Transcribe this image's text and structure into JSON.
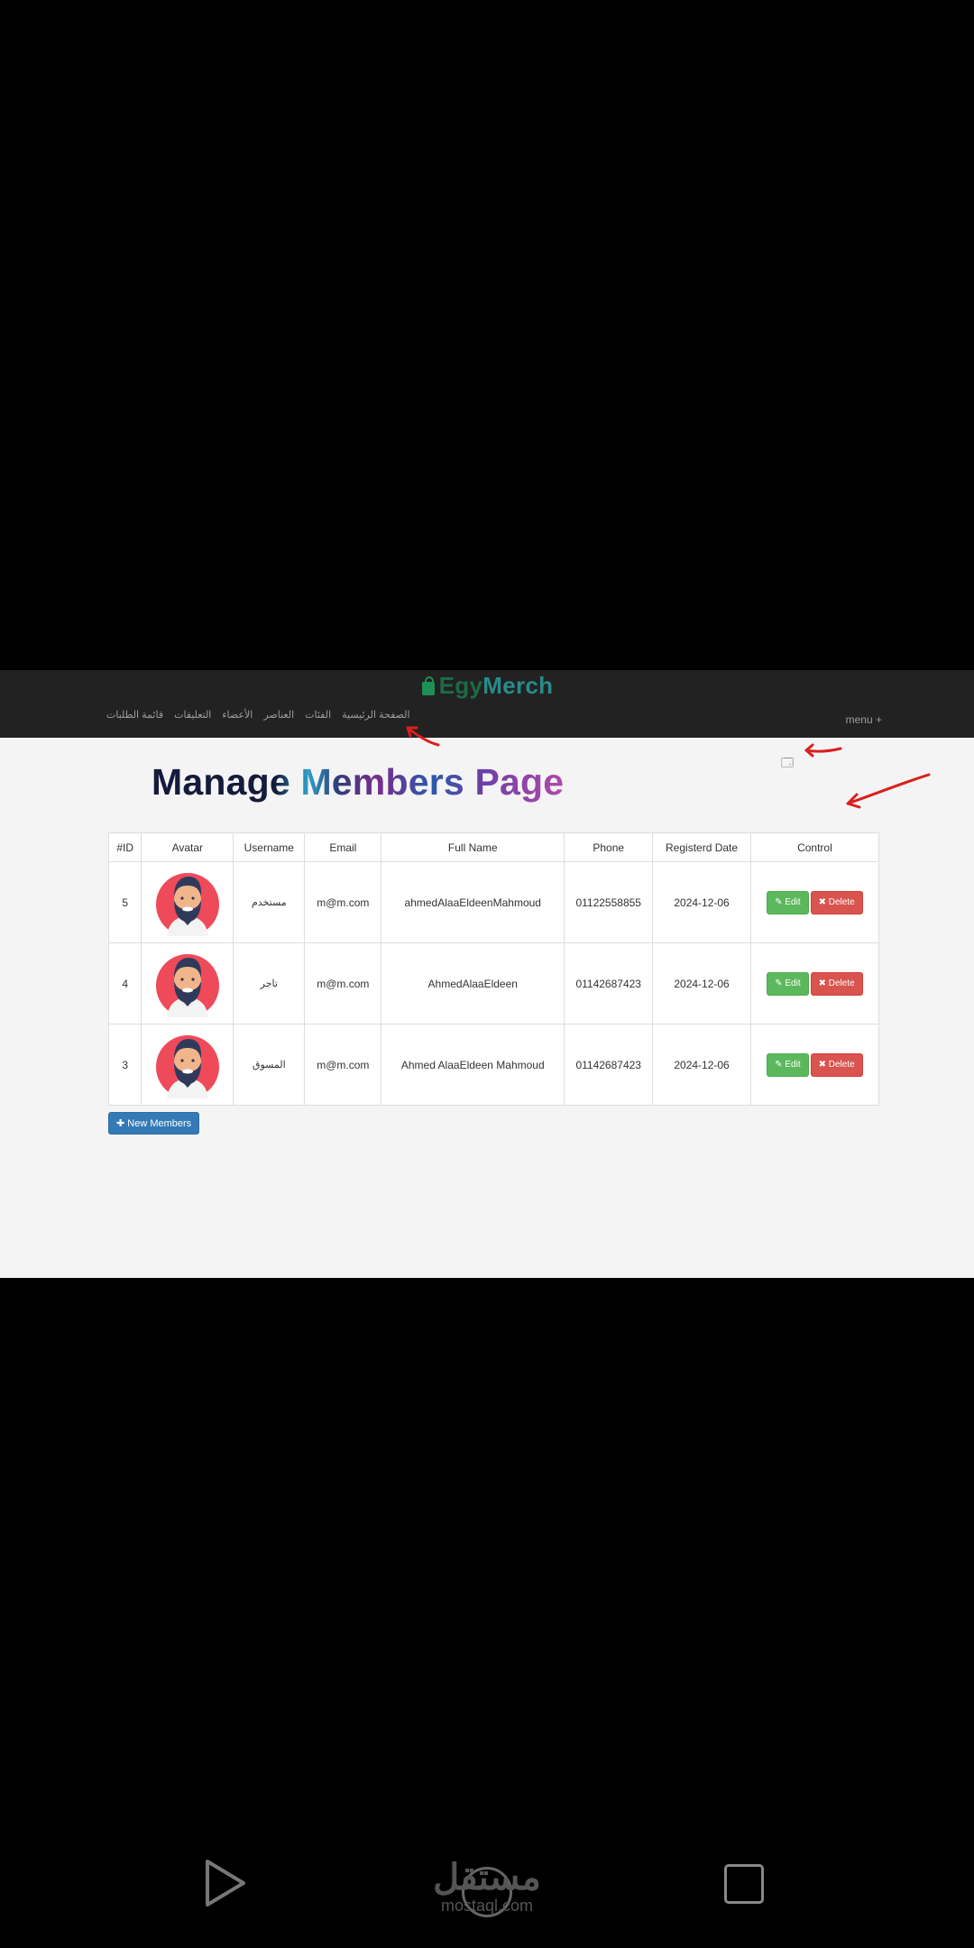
{
  "brand": {
    "part1": "Egy",
    "part2": "Merch"
  },
  "nav": {
    "links": [
      "الصفحة الرئيسية",
      "الفئات",
      "العناصر",
      "الأعضاء",
      "التعليقات",
      "قائمة الطلبات"
    ],
    "menu_label": "menu +"
  },
  "page_title": "Manage Members Page",
  "table": {
    "headers": [
      "#ID",
      "Avatar",
      "Username",
      "Email",
      "Full Name",
      "Phone",
      "Registerd Date",
      "Control"
    ],
    "rows": [
      {
        "id": "5",
        "username": "مستخدم",
        "email": "m@m.com",
        "full_name": "ahmedAlaaEldeenMahmoud",
        "phone": "01122558855",
        "date": "2024-12-06"
      },
      {
        "id": "4",
        "username": "تاجر",
        "email": "m@m.com",
        "full_name": "AhmedAlaaEldeen",
        "phone": "01142687423",
        "date": "2024-12-06"
      },
      {
        "id": "3",
        "username": "المسوق",
        "email": "m@m.com",
        "full_name": "Ahmed AlaaEldeen Mahmoud",
        "phone": "01142687423",
        "date": "2024-12-06"
      }
    ],
    "edit_label": "Edit",
    "delete_label": "Delete"
  },
  "new_members_label": "New Members",
  "watermark": {
    "ar": "مستقل",
    "en": "mostaql.com"
  },
  "colors": {
    "navbar_bg": "#222222",
    "edit": "#5cb85c",
    "delete": "#d9534f",
    "primary": "#337ab7",
    "annotation": "#d9201e"
  }
}
